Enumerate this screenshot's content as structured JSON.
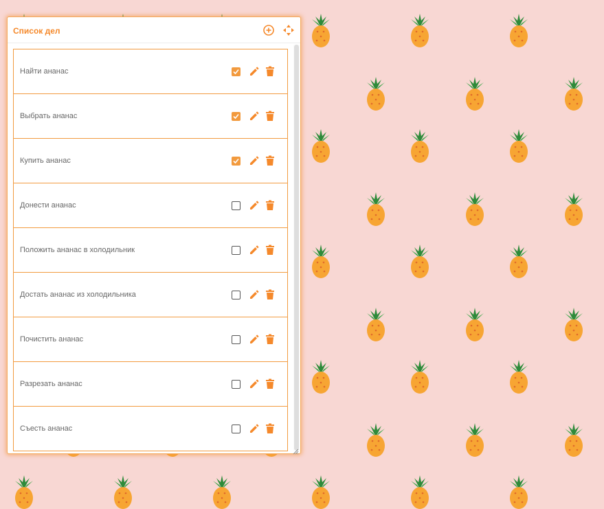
{
  "window": {
    "title": "Список дел",
    "add_icon": "plus-circle-icon",
    "move_icon": "move-arrows-icon"
  },
  "todos": [
    {
      "label": "Найти ананас",
      "done": true
    },
    {
      "label": "Выбрать ананас",
      "done": true
    },
    {
      "label": "Купить ананас",
      "done": true
    },
    {
      "label": "Донести ананас",
      "done": false
    },
    {
      "label": "Положить ананас в холодильник",
      "done": false
    },
    {
      "label": "Достать ананас из холодильника",
      "done": false
    },
    {
      "label": "Почистить ананас",
      "done": false
    },
    {
      "label": "Разрезать ананас",
      "done": false
    },
    {
      "label": "Съесть ананас",
      "done": false
    }
  ],
  "item_icons": {
    "edit": "pencil-icon",
    "delete": "trash-icon"
  },
  "colors": {
    "accent": "#f5892b",
    "background": "#f8d7d3",
    "pineapple_body": "#f7a533",
    "pineapple_leaves": "#2e8b3a"
  }
}
